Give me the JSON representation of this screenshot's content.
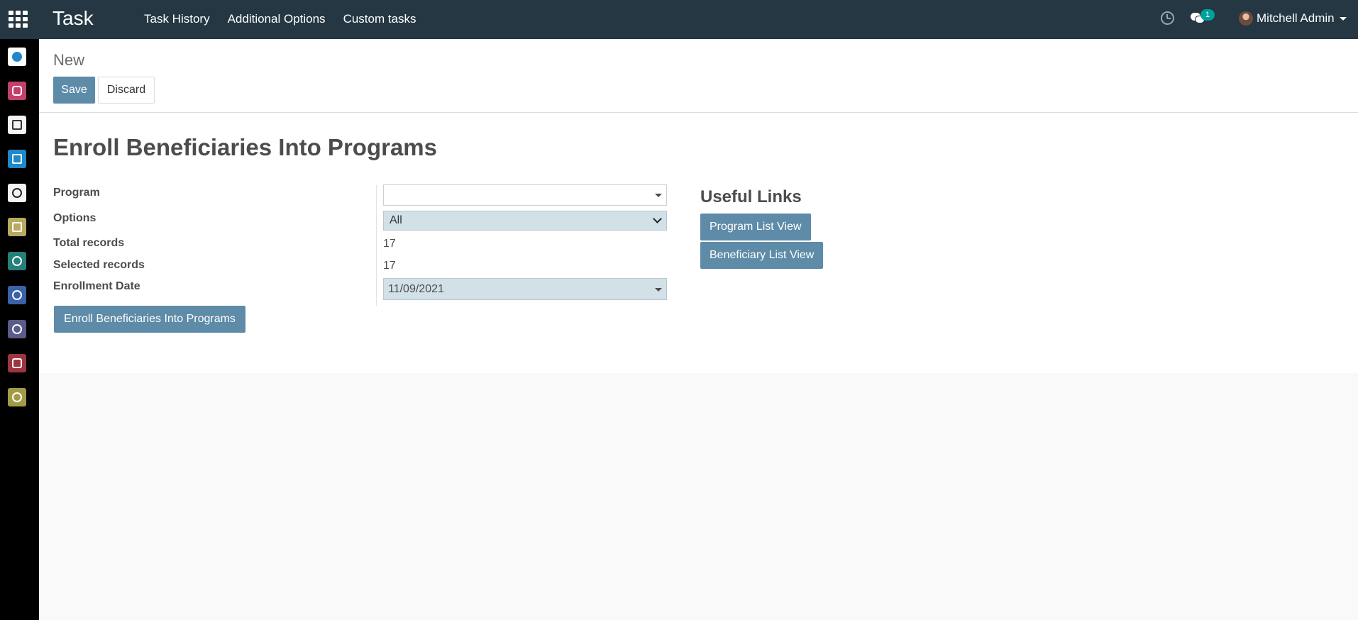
{
  "topbar": {
    "apps_icon": "grid-icon",
    "brand": "Task",
    "menu": [
      "Task History",
      "Additional Options",
      "Custom tasks"
    ],
    "activity_icon": "clock-icon",
    "messages_icon": "chat-icon",
    "messages_count": "1",
    "user_name": "Mitchell Admin"
  },
  "sidebar": {
    "items": [
      {
        "icon": "helpdesk-icon",
        "color": "#1e88c9"
      },
      {
        "icon": "discuss-icon",
        "color": "#c2416b"
      },
      {
        "icon": "payment-icon",
        "color": "#f4f4f4"
      },
      {
        "icon": "task-check-icon",
        "color": "#1e88c9"
      },
      {
        "icon": "eye-icon",
        "color": "#f4f4f4"
      },
      {
        "icon": "calendar-icon",
        "color": "#b7a960"
      },
      {
        "icon": "contacts-icon",
        "color": "#24807b"
      },
      {
        "icon": "support-icon",
        "color": "#3b62a8"
      },
      {
        "icon": "search-icon",
        "color": "#5b5b88"
      },
      {
        "icon": "apps-icon",
        "color": "#9c3540"
      },
      {
        "icon": "settings-icon",
        "color": "#a39a48"
      }
    ]
  },
  "control_panel": {
    "breadcrumb": "New",
    "save_label": "Save",
    "discard_label": "Discard"
  },
  "form": {
    "title": "Enroll Beneficiaries Into Programs",
    "fields": {
      "program_label": "Program",
      "program_value": "",
      "options_label": "Options",
      "options_value": "All",
      "total_label": "Total records",
      "total_value": "17",
      "selected_label": "Selected records",
      "selected_value": "17",
      "date_label": "Enrollment Date",
      "date_value": "11/09/2021"
    },
    "enroll_button": "Enroll Beneficiaries Into Programs"
  },
  "useful_links": {
    "title": "Useful Links",
    "program_list": "Program List View",
    "beneficiary_list": "Beneficiary List View"
  },
  "colors": {
    "topbar": "#243742",
    "primary_button": "#5e8ba8",
    "field_highlight": "#d2e0e7",
    "badge": "#00a09d"
  }
}
